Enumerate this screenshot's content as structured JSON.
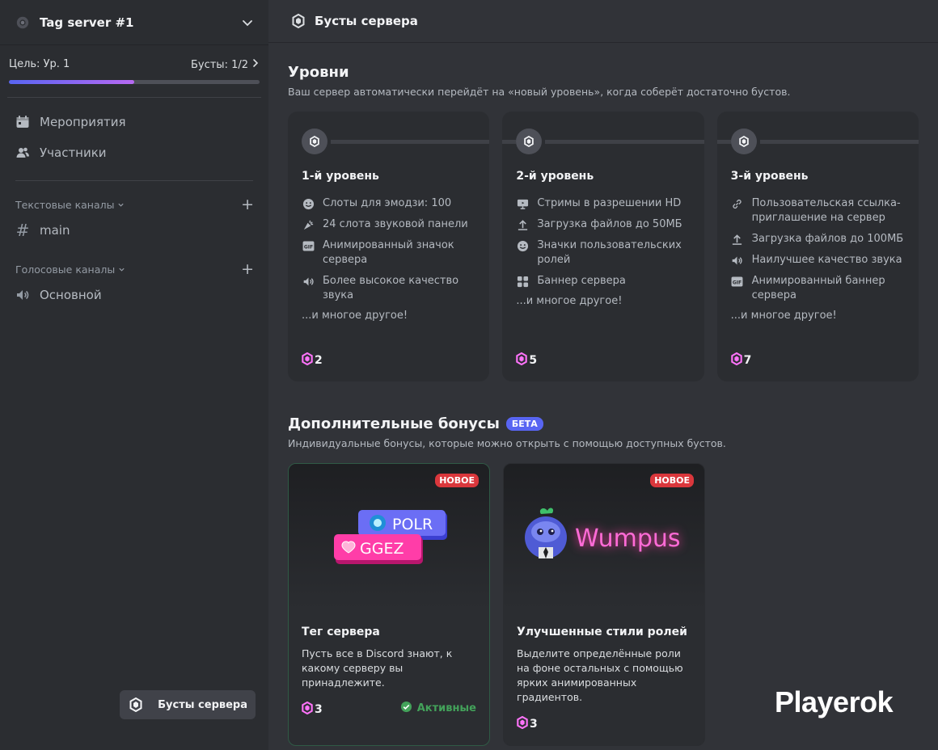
{
  "server": {
    "name": "Tag server #1"
  },
  "goal": {
    "left": "Цель: Ур. 1",
    "right": "Бусты: 1/2",
    "progress": 0.5
  },
  "nav": {
    "items": [
      {
        "label": "Мероприятия",
        "icon": "calendar-icon"
      },
      {
        "label": "Участники",
        "icon": "members-icon"
      },
      {
        "label": "Бусты сервера",
        "icon": "boost-icon"
      }
    ]
  },
  "categories": {
    "text": {
      "label": "Текстовые каналы",
      "channel": "main"
    },
    "voice": {
      "label": "Голосовые каналы",
      "channel": "Основной"
    }
  },
  "header": {
    "title": "Бусты сервера"
  },
  "levels": {
    "title": "Уровни",
    "desc": "Ваш сервер автоматически перейдёт на «новый уровень», когда соберёт достаточно бустов.",
    "tiers": [
      {
        "name": "1-й уровень",
        "perks": [
          "Слоты для эмодзи: 100",
          "24 слота звуковой панели",
          "Анимированный значок сервера",
          "Более высокое качество звука"
        ],
        "perk_icons": [
          "smile-icon",
          "soundboard-icon",
          "gif-icon",
          "speaker-icon"
        ],
        "more": "...и многое другое!",
        "cost": "2"
      },
      {
        "name": "2-й уровень",
        "perks": [
          "Стримы в разрешении HD",
          "Загрузка файлов до 50МБ",
          "Значки пользовательских ролей",
          "Баннер сервера"
        ],
        "perk_icons": [
          "screen-icon",
          "upload-icon",
          "smile-icon",
          "banner-icon"
        ],
        "more": "...и многое другое!",
        "cost": "5"
      },
      {
        "name": "3-й уровень",
        "perks": [
          "Пользовательская ссылка-приглашение на сервер",
          "Загрузка файлов до 100МБ",
          "Наилучшее качество звука",
          "Анимированный баннер сервера"
        ],
        "perk_icons": [
          "link-icon",
          "upload-icon",
          "speaker-icon",
          "gif-icon"
        ],
        "more": "...и многое другое!",
        "cost": "7"
      }
    ]
  },
  "bonuses": {
    "title": "Дополнительные бонусы",
    "badge": "БЕТА",
    "desc": "Индивидуальные бонусы, которые можно открыть с помощью доступных бустов.",
    "items": [
      {
        "new": "НОВОЕ",
        "name": "Тег сервера",
        "desc": "Пусть все в Discord знают, к какому серверу вы принадлежите.",
        "cost": "3",
        "status": "Активные",
        "tag1": "POLR",
        "tag2": "GGEZ"
      },
      {
        "new": "НОВОЕ",
        "name": "Улучшенные стили ролей",
        "desc": "Выделите определённые роли на фоне остальных с помощью ярких анимированных градиентов.",
        "cost": "3",
        "art_text": "Wumpus"
      }
    ]
  },
  "watermark": "Playerok",
  "colors": {
    "accent": "#5865f2",
    "boost": "#ff73fa",
    "new_badge": "#da373c",
    "active": "#43a25a"
  }
}
